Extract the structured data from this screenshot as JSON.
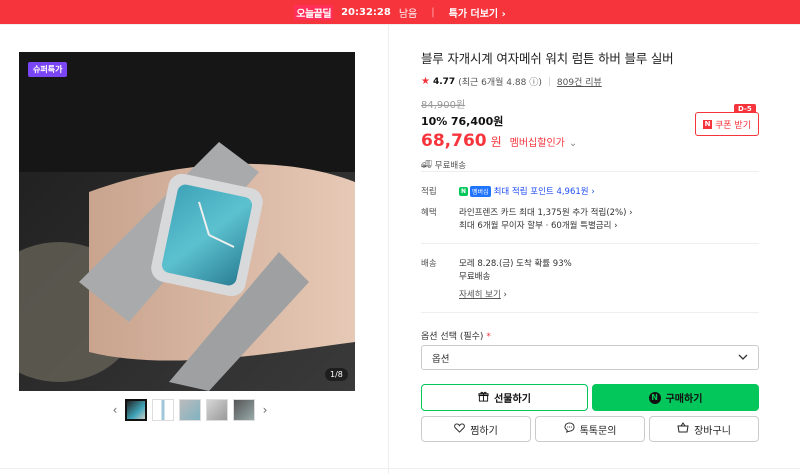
{
  "topbar": {
    "brand": "오늘끝딜",
    "timer": "20:32:28",
    "timer_suffix": "남음",
    "more_label": "특가 더보기",
    "more_icon": "chevron-right-icon"
  },
  "gallery": {
    "badge": "슈퍼특가",
    "counter": "1/8",
    "thumbnails": [
      "thumb-1",
      "thumb-2",
      "thumb-3",
      "thumb-4",
      "thumb-5"
    ],
    "prev_icon": "chevron-left-icon",
    "next_icon": "chevron-right-icon"
  },
  "product": {
    "title": "블루 자개시계 여자메쉬 워치 럼튼 하버 블루 실버",
    "rating": "4.77",
    "rating_note": "(최근 6개월 4.88",
    "review_count": "809건 리뷰",
    "original_price": "84,900원",
    "discount_pct": "10%",
    "discount_price": "76,400원",
    "final_price": "68,760",
    "final_unit": "원",
    "member_label": "멤버십할인가",
    "shipping_badge": "무료배송",
    "coupon_label": "쿠폰 받기",
    "coupon_dday": "D-5"
  },
  "benefits": {
    "points_label": "적립",
    "points_badge": "N",
    "points_badge2": "멤버십",
    "points_text": "최대 적립 포인트 4,961원",
    "perks_label": "혜택",
    "perks_line1": "라인프렌즈 카드 최대 1,375원 추가 적립(2%)",
    "perks_line2": "최대 6개월 무이자 할부 · 60개월 특별금리",
    "delivery_label": "배송",
    "delivery_line1": "모레 8.28.(금) 도착 확률 93%",
    "delivery_line2": "무료배송",
    "delivery_detail": "자세히 보기"
  },
  "options": {
    "label": "옵션 선택 (필수)",
    "required_mark": "*",
    "select_value": "옵션"
  },
  "actions": {
    "gift": "선물하기",
    "buy": "구매하기",
    "buy_badge": "N",
    "wish": "찜하기",
    "talk": "톡톡문의",
    "cart": "장바구니"
  },
  "colors": {
    "accent": "#f5343c",
    "naver_green": "#03c75a",
    "sale_badge": "#7a45f5"
  }
}
